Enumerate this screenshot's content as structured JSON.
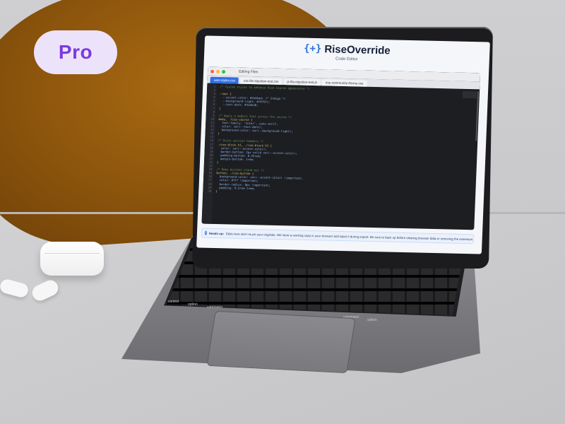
{
  "badge": {
    "label": "Pro"
  },
  "app": {
    "brand_mark": "{+}",
    "brand_name": "RiseOverride",
    "subtitle": "Code Editor"
  },
  "editor": {
    "window_title": "Editing Files",
    "tabs": [
      {
        "label": "user-styles.css",
        "active": true
      },
      {
        "label": "css file-injection-test.css",
        "active": false
      },
      {
        "label": "js file-injection-test.js",
        "active": false
      },
      {
        "label": "rise-community-theme.css",
        "active": false
      }
    ],
    "line_numbers": [
      "1",
      "2",
      "3",
      "4",
      "5",
      "6",
      "7",
      "8",
      "9",
      "10",
      "11",
      "12",
      "13",
      "14",
      "15",
      "16",
      "17",
      "18",
      "19",
      "20",
      "21",
      "22",
      "23",
      "24",
      "25",
      "26",
      "27",
      "28",
      "29",
      "30"
    ],
    "code_lines": [
      "/* Custom styles to enhance Rise course appearance */",
      "",
      ":root {",
      "  --accent-color: #2e4bad; /* Indigo */",
      "  --background-light: #f4f6fc;",
      "  --text-dark: #1a2b38;",
      "}",
      "",
      "/* Apply a modern font across the course */",
      "body, .rise-course {",
      "  font-family: 'Inter', sans-serif;",
      "  color: var(--text-dark);",
      "  background-color: var(--background-light);",
      "}",
      "",
      "/* Style section headers */",
      ".rise-block h1, .rise-block h2 {",
      "  color: var(--accent-color);",
      "  border-bottom: 2px solid var(--accent-color);",
      "  padding-bottom: 0.25rem;",
      "  margin-bottom: 1rem;",
      "}",
      "",
      "/* Make buttons stand out */",
      "button, .rise-button {",
      "  background-color: var(--accent-color) !important;",
      "  color: #fff !important;",
      "  border-radius: 8px !important;",
      "  padding: 0.5rem 1rem;",
      "}"
    ]
  },
  "notice": {
    "title": "Heads up:",
    "text": "Edits here don't touch your originals. We store a working copy in your browser and inject it during export. Be sure to back up before clearing browser data or removing the extension."
  },
  "keyboard": {
    "control_label": "control",
    "option_left_label": "option",
    "command_left_label": "command",
    "command_right_label": "command",
    "option_right_label": "option"
  },
  "colors": {
    "accent": "#2f6fe5",
    "badge_text": "#7c3ae0",
    "badge_bg": "#ece3fb",
    "editor_bg": "#1d1e22"
  }
}
